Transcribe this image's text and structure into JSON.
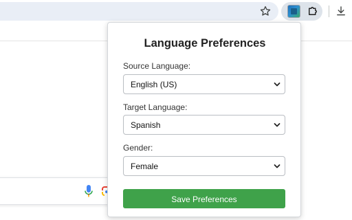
{
  "popup": {
    "title": "Language Preferences",
    "fields": [
      {
        "label": "Source Language:",
        "value": "English (US)"
      },
      {
        "label": "Target Language:",
        "value": "Spanish"
      },
      {
        "label": "Gender:",
        "value": "Female"
      }
    ],
    "save_label": "Save Preferences"
  },
  "icons": {
    "star": "star-icon",
    "extension": "extension-icon",
    "puzzle": "puzzle-icon",
    "download": "download-icon",
    "mic": "mic-icon",
    "lens": "lens-icon",
    "chevron": "chevron-down-icon"
  },
  "colors": {
    "save_button": "#3fa24a",
    "omnibox": "#e9eef6",
    "extension_pill": "#dde3ea"
  }
}
